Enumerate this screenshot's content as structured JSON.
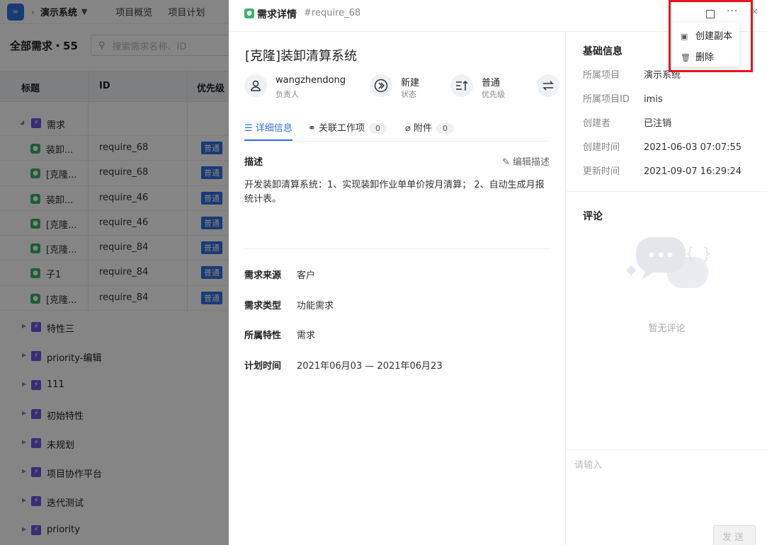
{
  "topbar": {
    "logo": "∞",
    "project": "演示系统",
    "nav": [
      "项目概览",
      "项目计划"
    ]
  },
  "list": {
    "title": "全部需求・55",
    "search_placeholder": "搜索需求名称、ID",
    "columns": [
      "标题",
      "ID",
      "优先级"
    ],
    "open_group": "需求",
    "rows": [
      {
        "name": "装卸...",
        "id": "require_68",
        "priority": "普通"
      },
      {
        "name": "[克隆...",
        "id": "require_68",
        "priority": "普通"
      },
      {
        "name": "装卸...",
        "id": "require_46",
        "priority": "普通"
      },
      {
        "name": "[克隆...",
        "id": "require_46",
        "priority": "普通"
      },
      {
        "name": "[克隆...",
        "id": "require_84",
        "priority": "普通"
      },
      {
        "name": "子1",
        "id": "require_84",
        "priority": "普通"
      },
      {
        "name": "[克隆...",
        "id": "require_84",
        "priority": "普通"
      }
    ],
    "groups": [
      "特性三",
      "priority-编辑",
      "111",
      "初始特性",
      "未规划",
      "项目协作平台",
      "迭代测试",
      "priority"
    ]
  },
  "drawer": {
    "header_title": "需求详情",
    "header_id": "#require_68",
    "title": "[克隆]装卸清算系统",
    "meta": [
      {
        "value": "wangzhendong",
        "label": "负责人"
      },
      {
        "value": "新建",
        "label": "状态"
      },
      {
        "value": "普通",
        "label": "优先级"
      }
    ],
    "tabs": [
      {
        "label": "详细信息"
      },
      {
        "label": "关联工作项",
        "count": "0"
      },
      {
        "label": "附件",
        "count": "0"
      }
    ],
    "desc_heading": "描述",
    "edit_desc": "编辑描述",
    "description": "开发装卸清算系统：1、实现装卸作业单单价按月清算； 2、自动生成月报统计表。",
    "attributes": [
      {
        "key": "需求来源",
        "value": "客户"
      },
      {
        "key": "需求类型",
        "value": "功能需求"
      },
      {
        "key": "所属特性",
        "value": "需求"
      },
      {
        "key": "计划时间",
        "value": "2021年06月03 — 2021年06月23"
      }
    ],
    "basic_heading": "基础信息",
    "basic": [
      {
        "key": "所属项目",
        "value": "演示系统"
      },
      {
        "key": "所属项目ID",
        "value": "imis"
      },
      {
        "key": "创建者",
        "value": "已注销"
      },
      {
        "key": "创建时间",
        "value": "2021-06-03 07:07:55"
      },
      {
        "key": "更新时间",
        "value": "2021-09-07 16:29:24"
      }
    ],
    "comment_heading": "评论",
    "empty_comments": "暂无评论",
    "comment_placeholder": "请输入",
    "send_label": "发送"
  },
  "menu": {
    "copy": "创建副本",
    "delete": "删除"
  },
  "colors": {
    "primary": "#2f6fe0",
    "feature": "#6d57e0",
    "requirement": "#38b26b",
    "highlight": "#e5161d"
  }
}
